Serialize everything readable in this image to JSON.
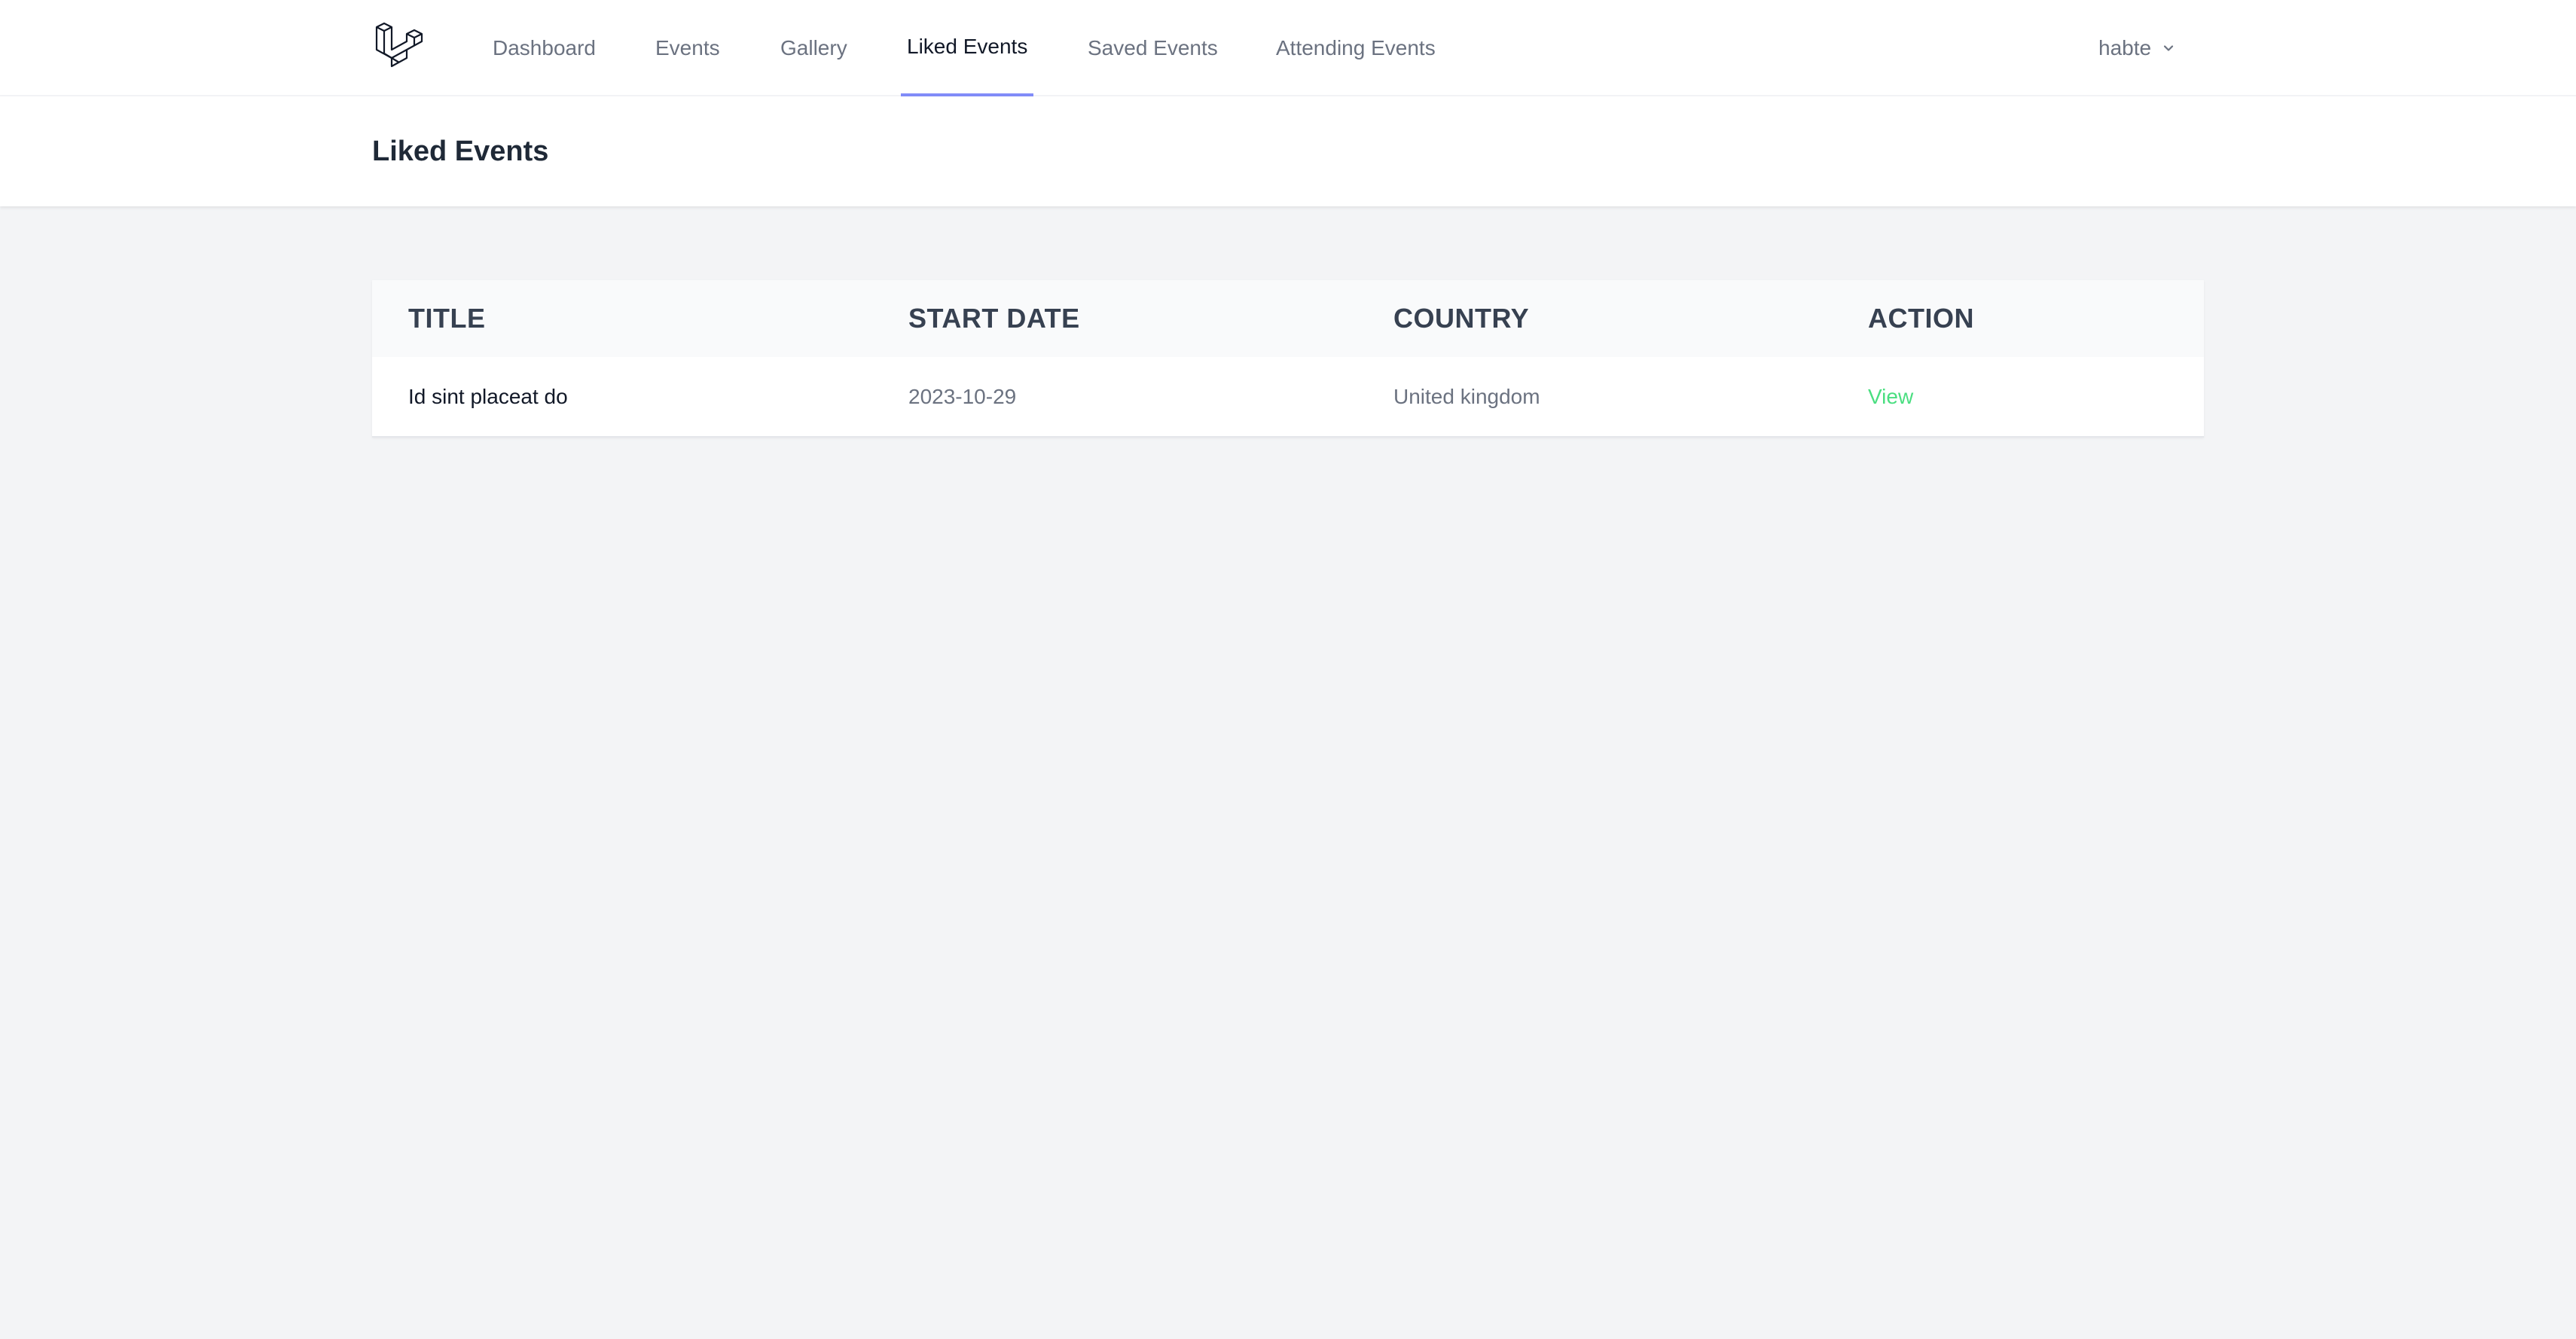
{
  "nav": {
    "logo_icon": "laravel-logo-icon",
    "links": [
      {
        "label": "Dashboard",
        "active": false
      },
      {
        "label": "Events",
        "active": false
      },
      {
        "label": "Gallery",
        "active": false
      },
      {
        "label": "Liked Events",
        "active": true
      },
      {
        "label": "Saved Events",
        "active": false
      },
      {
        "label": "Attending Events",
        "active": false
      }
    ],
    "user": {
      "name": "habte",
      "icon": "chevron-down-icon"
    }
  },
  "header": {
    "title": "Liked Events"
  },
  "table": {
    "columns": [
      "TITLE",
      "START DATE",
      "COUNTRY",
      "ACTION"
    ],
    "rows": [
      {
        "title": "Id sint placeat do",
        "start_date": "2023-10-29",
        "country": "United kingdom",
        "action": "View"
      }
    ]
  },
  "colors": {
    "active_underline": "#818cf8",
    "action_link": "#4ade80",
    "page_background": "#f3f4f6"
  }
}
